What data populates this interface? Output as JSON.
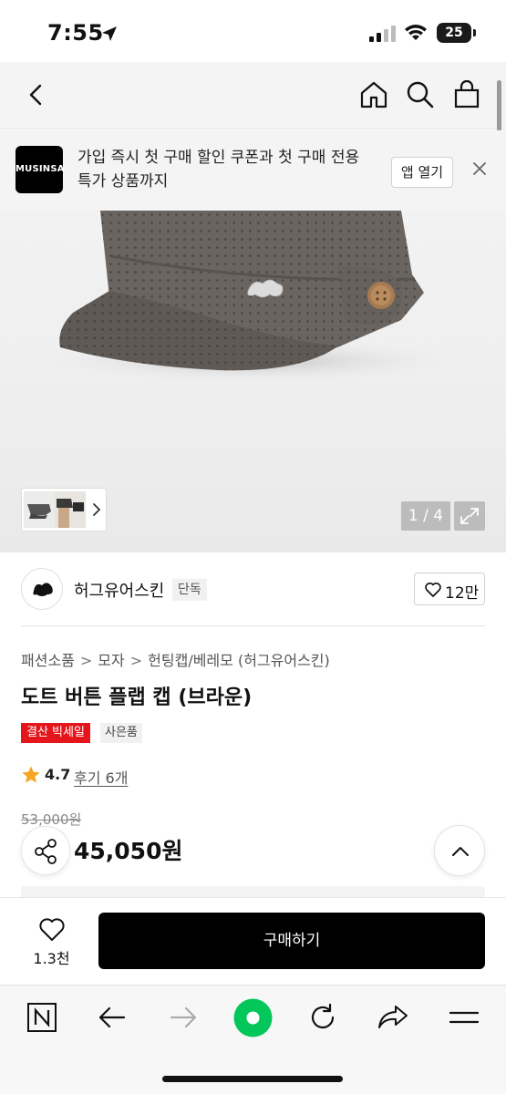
{
  "status_bar": {
    "time": "7:55",
    "battery": "25"
  },
  "header": {
    "icons": [
      "back-icon",
      "home-icon",
      "search-icon",
      "cart-bag-icon"
    ]
  },
  "banner": {
    "logo_text": "MUSINSA",
    "message": "가입 즉시 첫 구매 할인 쿠폰과 첫 구매 전용 특가 상품까지",
    "open_app_label": "앱 열기"
  },
  "gallery": {
    "counter": "1 / 4"
  },
  "brand": {
    "name": "허그유어스킨",
    "tag": "단독",
    "like_count": "12만"
  },
  "breadcrumb": [
    "패션소품",
    "모자",
    "헌팅캡/베레모 (허그유어스킨)"
  ],
  "product": {
    "title": "도트 버튼 플랩 캡 (브라운)",
    "badge_sale": "결산 빅세일",
    "badge_gift": "사은품",
    "rating": "4.7",
    "review_link": "후기 6개",
    "price_original": "53,000원",
    "price_final": "45,050원"
  },
  "purchase_bar": {
    "wish_count": "1.3천",
    "buy_label": "구매하기"
  },
  "colors": {
    "accent_sale": "#e4161c",
    "buy_button": "#000000",
    "browser_green": "#03c75a",
    "rating_star": "#f5a623"
  },
  "browser_toolbar": {
    "icons": [
      "naver-n-icon",
      "back-arrow-icon",
      "forward-arrow-icon",
      "green-home-icon",
      "reload-icon",
      "share-arrow-icon",
      "menu-icon"
    ]
  }
}
